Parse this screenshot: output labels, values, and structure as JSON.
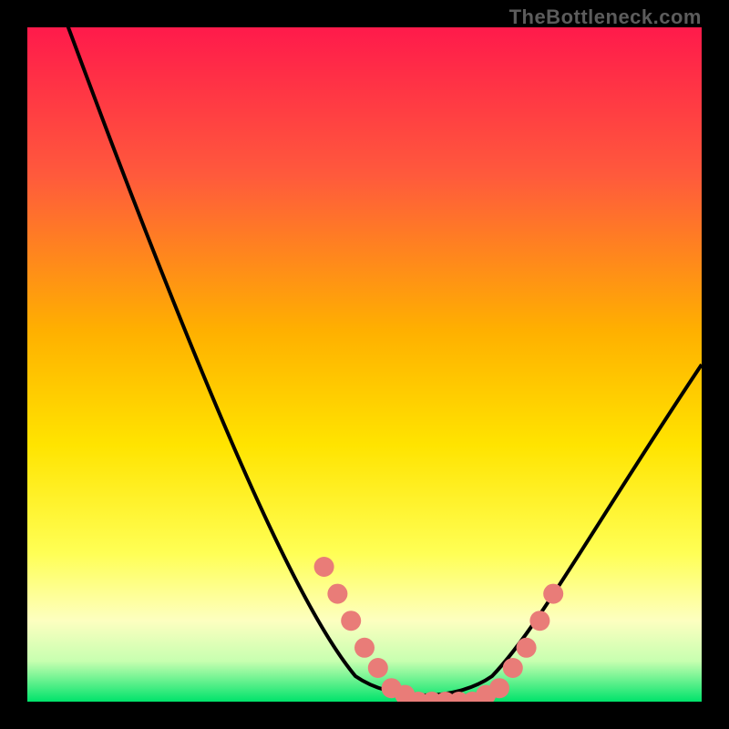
{
  "watermark": "TheBottleneck.com",
  "colors": {
    "background": "#000000",
    "gradient_top": "#ff1a4b",
    "gradient_mid_upper": "#ff6a3a",
    "gradient_mid": "#ffd400",
    "gradient_mid_lower": "#ffff66",
    "gradient_lower": "#d7ffb0",
    "gradient_bottom": "#00e36b",
    "curve": "#000000",
    "markers": "#e97c78"
  },
  "chart_data": {
    "type": "line",
    "title": "",
    "xlabel": "",
    "ylabel": "",
    "xlim": [
      0,
      100
    ],
    "ylim": [
      0,
      100
    ],
    "series": [
      {
        "name": "bottleneck-curve",
        "x": [
          0,
          4,
          8,
          12,
          16,
          20,
          24,
          28,
          32,
          36,
          40,
          44,
          48,
          52,
          56,
          60,
          64,
          68,
          72,
          76,
          80,
          84,
          88,
          92,
          96,
          100
        ],
        "values": [
          110,
          100,
          92,
          84,
          76,
          68,
          60,
          52,
          44,
          36,
          28,
          20,
          12,
          5,
          1,
          0,
          0,
          0,
          1,
          5,
          12,
          20,
          28,
          36,
          44,
          52
        ]
      }
    ],
    "markers": {
      "name": "highlight-dots",
      "x": [
        44,
        46,
        48,
        50,
        52,
        54,
        56,
        58,
        60,
        62,
        64,
        66,
        68,
        70,
        72,
        74,
        76,
        78
      ],
      "values": [
        20,
        16,
        12,
        8,
        5,
        2,
        1,
        0,
        0,
        0,
        0,
        0,
        1,
        2,
        5,
        8,
        12,
        16
      ]
    }
  }
}
